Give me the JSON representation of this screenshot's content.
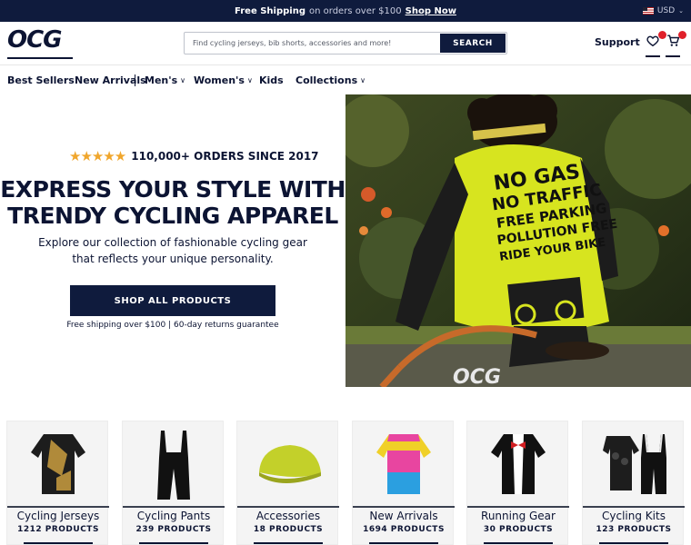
{
  "announcement": {
    "bold": "Free Shipping",
    "middle": "on orders over $100",
    "link": "Shop Now"
  },
  "currency": {
    "label": "USD",
    "icon": "us-flag-icon"
  },
  "header": {
    "logo": "OCG",
    "search_placeholder": "Find cycling jerseys, bib shorts, accessories and more!",
    "search_button": "SEARCH",
    "support": "Support"
  },
  "nav": {
    "items": [
      {
        "label": "Best Sellers",
        "dropdown": false
      },
      {
        "label": "New Arrivals",
        "dropdown": false
      },
      {
        "label": "Men's",
        "dropdown": true
      },
      {
        "label": "Women's",
        "dropdown": true
      },
      {
        "label": "Kids",
        "dropdown": false
      },
      {
        "label": "Collections",
        "dropdown": true
      }
    ]
  },
  "hero": {
    "rating_text": "110,000+ ORDERS SINCE 2017",
    "title_line1": "EXPRESS YOUR STYLE WITH",
    "title_line2": "TRENDY CYCLING APPAREL",
    "sub_line1": "Explore our collection of fashionable cycling gear",
    "sub_line2": "that reflects your unique personality.",
    "cta": "SHOP ALL PRODUCTS",
    "guarantee": "Free shipping over $100 | 60-day returns guarantee",
    "jersey_text": [
      "NO GAS",
      "NO TRAFFIC",
      "FREE PARKING",
      "POLLUTION FREE",
      "RIDE YOUR BIKE"
    ]
  },
  "categories": [
    {
      "name": "Cycling Jerseys",
      "count": "1212 PRODUCTS"
    },
    {
      "name": "Cycling Pants",
      "count": "239 PRODUCTS"
    },
    {
      "name": "Accessories",
      "count": "18 PRODUCTS"
    },
    {
      "name": "New Arrivals",
      "count": "1694 PRODUCTS"
    },
    {
      "name": "Running Gear",
      "count": "30 PRODUCTS"
    },
    {
      "name": "Cycling Kits",
      "count": "123 PRODUCTS"
    }
  ],
  "colors": {
    "navy": "#0f1b3d",
    "star": "#f0a62c",
    "badge": "#e0202a",
    "jersey_yellow": "#d7e41f"
  }
}
